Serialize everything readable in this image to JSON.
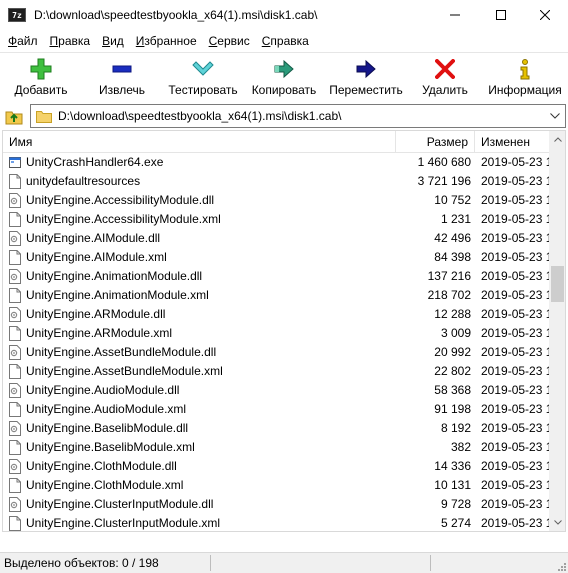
{
  "window": {
    "title": "D:\\download\\speedtestbyookla_x64(1).msi\\disk1.cab\\",
    "app_icon": "7z"
  },
  "menu": [
    {
      "label": "Файл",
      "accel": "Ф",
      "rest": "айл"
    },
    {
      "label": "Правка",
      "accel": "П",
      "rest": "равка"
    },
    {
      "label": "Вид",
      "accel": "В",
      "rest": "ид"
    },
    {
      "label": "Избранное",
      "accel": "И",
      "rest": "збранное"
    },
    {
      "label": "Сервис",
      "accel": "С",
      "rest": "ервис"
    },
    {
      "label": "Справка",
      "accel": "С",
      "rest": "правка"
    }
  ],
  "toolbar": {
    "add": "Добавить",
    "extract": "Извлечь",
    "test": "Тестировать",
    "copy": "Копировать",
    "move": "Переместить",
    "delete": "Удалить",
    "info": "Информация"
  },
  "address": {
    "path": "D:\\download\\speedtestbyookla_x64(1).msi\\disk1.cab\\"
  },
  "columns": {
    "name": "Имя",
    "size": "Размер",
    "modified": "Изменен"
  },
  "files": [
    {
      "name": "UnityCrashHandler64.exe",
      "size": "1 460 680",
      "date": "2019-05-23 1",
      "icon": "exe"
    },
    {
      "name": "unitydefaultresources",
      "size": "3 721 196",
      "date": "2019-05-23 1",
      "icon": "file"
    },
    {
      "name": "UnityEngine.AccessibilityModule.dll",
      "size": "10 752",
      "date": "2019-05-23 1",
      "icon": "dll"
    },
    {
      "name": "UnityEngine.AccessibilityModule.xml",
      "size": "1 231",
      "date": "2019-05-23 1",
      "icon": "file"
    },
    {
      "name": "UnityEngine.AIModule.dll",
      "size": "42 496",
      "date": "2019-05-23 1",
      "icon": "dll"
    },
    {
      "name": "UnityEngine.AIModule.xml",
      "size": "84 398",
      "date": "2019-05-23 1",
      "icon": "file"
    },
    {
      "name": "UnityEngine.AnimationModule.dll",
      "size": "137 216",
      "date": "2019-05-23 1",
      "icon": "dll"
    },
    {
      "name": "UnityEngine.AnimationModule.xml",
      "size": "218 702",
      "date": "2019-05-23 1",
      "icon": "file"
    },
    {
      "name": "UnityEngine.ARModule.dll",
      "size": "12 288",
      "date": "2019-05-23 1",
      "icon": "dll"
    },
    {
      "name": "UnityEngine.ARModule.xml",
      "size": "3 009",
      "date": "2019-05-23 1",
      "icon": "file"
    },
    {
      "name": "UnityEngine.AssetBundleModule.dll",
      "size": "20 992",
      "date": "2019-05-23 1",
      "icon": "dll"
    },
    {
      "name": "UnityEngine.AssetBundleModule.xml",
      "size": "22 802",
      "date": "2019-05-23 1",
      "icon": "file"
    },
    {
      "name": "UnityEngine.AudioModule.dll",
      "size": "58 368",
      "date": "2019-05-23 1",
      "icon": "dll"
    },
    {
      "name": "UnityEngine.AudioModule.xml",
      "size": "91 198",
      "date": "2019-05-23 1",
      "icon": "file"
    },
    {
      "name": "UnityEngine.BaselibModule.dll",
      "size": "8 192",
      "date": "2019-05-23 1",
      "icon": "dll"
    },
    {
      "name": "UnityEngine.BaselibModule.xml",
      "size": "382",
      "date": "2019-05-23 1",
      "icon": "file"
    },
    {
      "name": "UnityEngine.ClothModule.dll",
      "size": "14 336",
      "date": "2019-05-23 1",
      "icon": "dll"
    },
    {
      "name": "UnityEngine.ClothModule.xml",
      "size": "10 131",
      "date": "2019-05-23 1",
      "icon": "file"
    },
    {
      "name": "UnityEngine.ClusterInputModule.dll",
      "size": "9 728",
      "date": "2019-05-23 1",
      "icon": "dll"
    },
    {
      "name": "UnityEngine.ClusterInputModule.xml",
      "size": "5 274",
      "date": "2019-05-23 1",
      "icon": "file"
    }
  ],
  "status": {
    "selected": "Выделено объектов: 0 / 198"
  }
}
